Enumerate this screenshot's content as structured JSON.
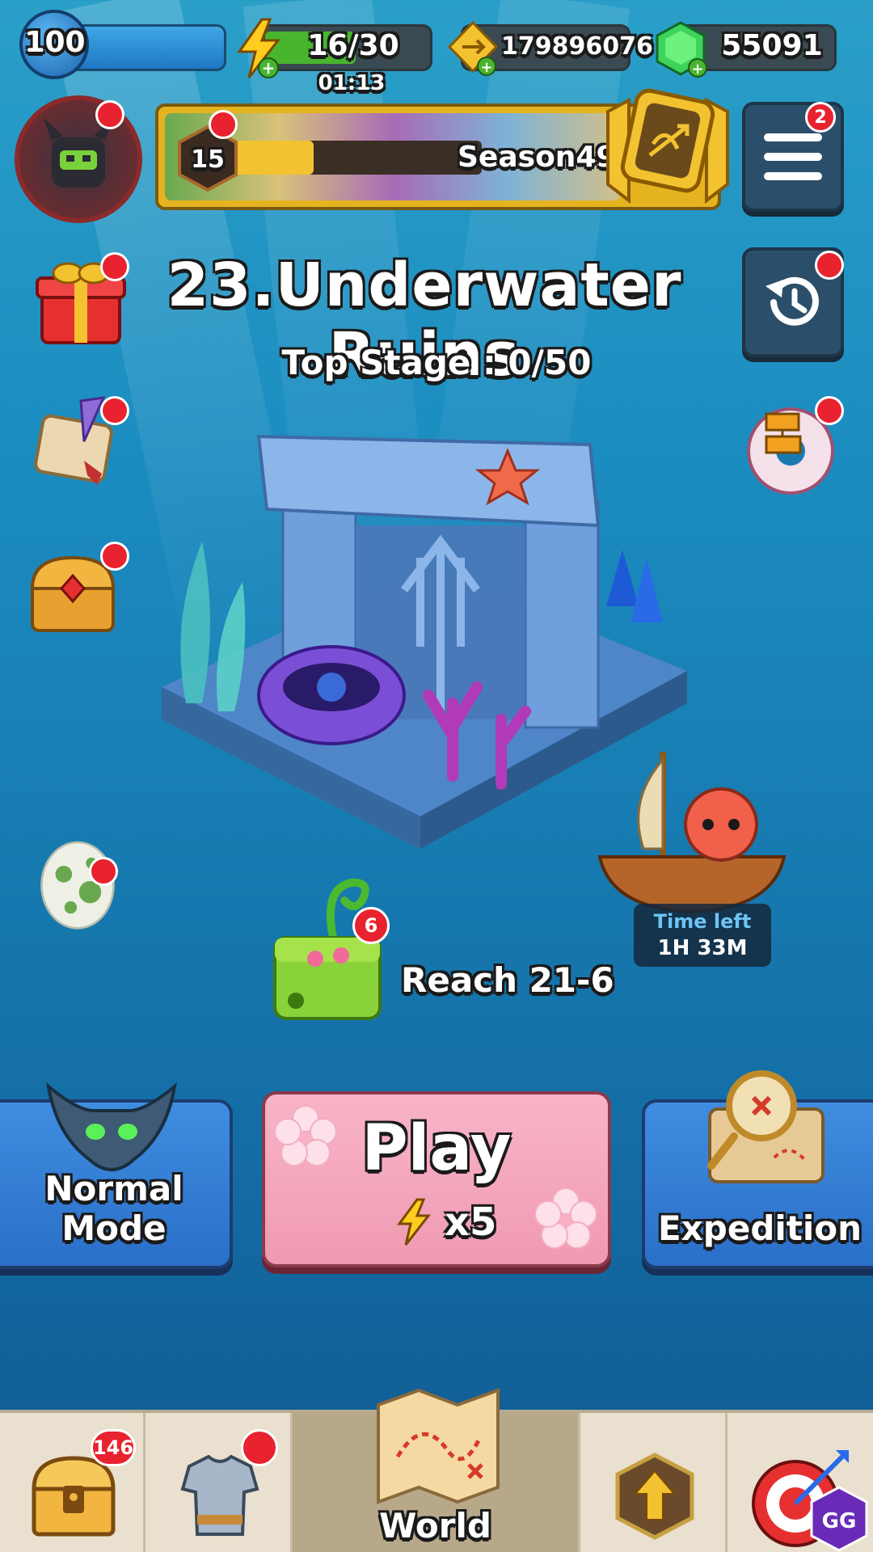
{
  "top_bar": {
    "level": "100",
    "energy": "16/30",
    "energy_timer": "01:13",
    "gold": "179896076",
    "gems": "55091"
  },
  "season": {
    "tier": "15",
    "label": "Season49",
    "progress": 0.35
  },
  "menu": {
    "badge": "2"
  },
  "chapter": {
    "title": "23.Underwater Ruins",
    "top_stage": "Top Stage : 0/50"
  },
  "rewards": {
    "chest_badge": "6",
    "reach_label": "Reach 21-6"
  },
  "boat": {
    "time_left_label": "Time left",
    "time_left": "1H 33M"
  },
  "modes": {
    "normal": "Normal Mode",
    "play": "Play",
    "play_cost": "x5",
    "expedition": "Expedition"
  },
  "nav": {
    "shop_badge": "146",
    "world": "World"
  },
  "colors": {
    "play_pink": "#f6a9bf",
    "mode_blue": "#3f8de0",
    "badge_red": "#e8222e",
    "energy_green": "#49b52f"
  }
}
